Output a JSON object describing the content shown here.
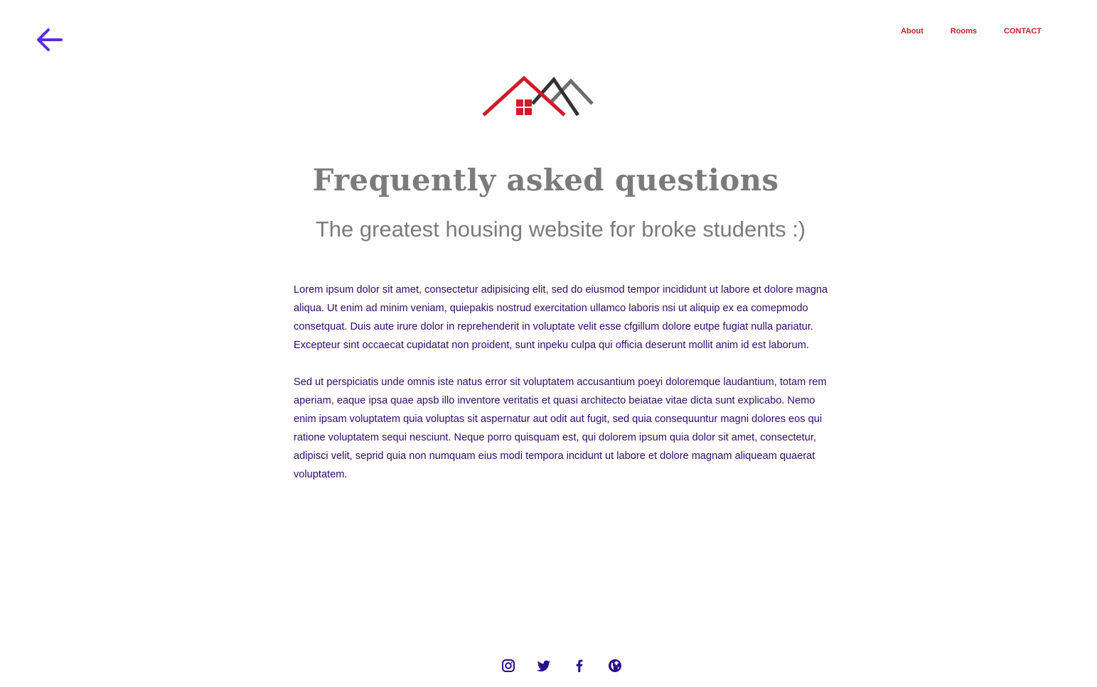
{
  "nav": {
    "back_icon": "arrow-left-icon",
    "links": [
      {
        "label": "About"
      },
      {
        "label": "Rooms"
      },
      {
        "label": "CONTACT"
      }
    ]
  },
  "header": {
    "logo_icon": "house-roofs-logo"
  },
  "main": {
    "title": "Frequently asked questions",
    "subtitle": "The greatest housing website for broke students :)",
    "paragraphs": [
      "Lorem ipsum dolor sit amet, consectetur adipisicing elit, sed do eiusmod tempor incididunt ut labore et dolore magna aliqua. Ut enim ad minim veniam, quiepakis nostrud exercitation ullamco laboris nsi ut aliquip ex ea comepmodo consetquat. Duis aute irure dolor in reprehenderit in voluptate velit esse cfgillum dolore eutpe fugiat nulla pariatur. Excepteur sint occaecat cupidatat non proident, sunt inpeku culpa qui officia deserunt mollit anim id est laborum.",
      "Sed ut perspiciatis unde omnis iste natus error sit voluptatem accusantium poeyi doloremque laudantium, totam rem aperiam, eaque ipsa quae apsb illo inventore veritatis et quasi architecto beiatae vitae dicta sunt explicabo. Nemo enim ipsam voluptatem quia voluptas sit aspernatur aut odit aut fugit, sed quia consequuntur magni dolores eos qui ratione voluptatem sequi nesciunt. Neque porro quisquam est, qui dolorem ipsum quia dolor sit amet, consectetur, adipisci velit, seprid quia non numquam eius modi tempora incidunt ut labore et dolore magnam aliqueam quaerat voluptatem."
    ]
  },
  "footer": {
    "social_icons": [
      "instagram-icon",
      "twitter-icon",
      "facebook-icon",
      "globe-icon"
    ]
  },
  "colors": {
    "accent_red": "#d11a2a",
    "back_arrow": "#5b2be0",
    "heading_gray": "#7b7b7b",
    "body_text": "#2e0a6a",
    "social_icon": "#2a0f8c"
  }
}
